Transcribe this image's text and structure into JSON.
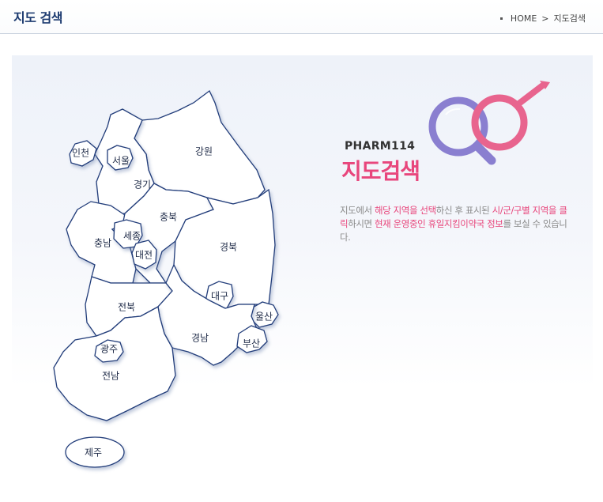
{
  "header": {
    "title": "지도 검색",
    "breadcrumb": {
      "home": "HOME",
      "separator": ">",
      "current": "지도검색"
    }
  },
  "map": {
    "regions": [
      {
        "id": "incheon",
        "label": "인천"
      },
      {
        "id": "seoul",
        "label": "서울"
      },
      {
        "id": "gyeonggi",
        "label": "경기"
      },
      {
        "id": "gangwon",
        "label": "강원"
      },
      {
        "id": "chungbuk",
        "label": "충북"
      },
      {
        "id": "chungnam",
        "label": "충남"
      },
      {
        "id": "sejong",
        "label": "세종"
      },
      {
        "id": "daejeon",
        "label": "대전"
      },
      {
        "id": "gyeongbuk",
        "label": "경북"
      },
      {
        "id": "daegu",
        "label": "대구"
      },
      {
        "id": "jeonbuk",
        "label": "전북"
      },
      {
        "id": "ulsan",
        "label": "울산"
      },
      {
        "id": "gyeongnam",
        "label": "경남"
      },
      {
        "id": "busan",
        "label": "부산"
      },
      {
        "id": "gwangju",
        "label": "광주"
      },
      {
        "id": "jeonnam",
        "label": "전남"
      },
      {
        "id": "jeju",
        "label": "제주"
      }
    ]
  },
  "info": {
    "brand": "PHARM114",
    "title": "지도검색",
    "desc": {
      "p1": "지도에서 ",
      "p2": "해당 지역을 선택",
      "p3": "하신 후 표시된 ",
      "p4": "시/군/구별 지역을 클릭",
      "p5": "하시면 ",
      "p6": "현재 운영중인 휴일지킴이약국 정보",
      "p7": "를 보실 수 있습니다."
    },
    "colors": {
      "accent": "#e8467c",
      "lens_purple": "#8a7fd0",
      "navy": "#1d3b70"
    }
  }
}
